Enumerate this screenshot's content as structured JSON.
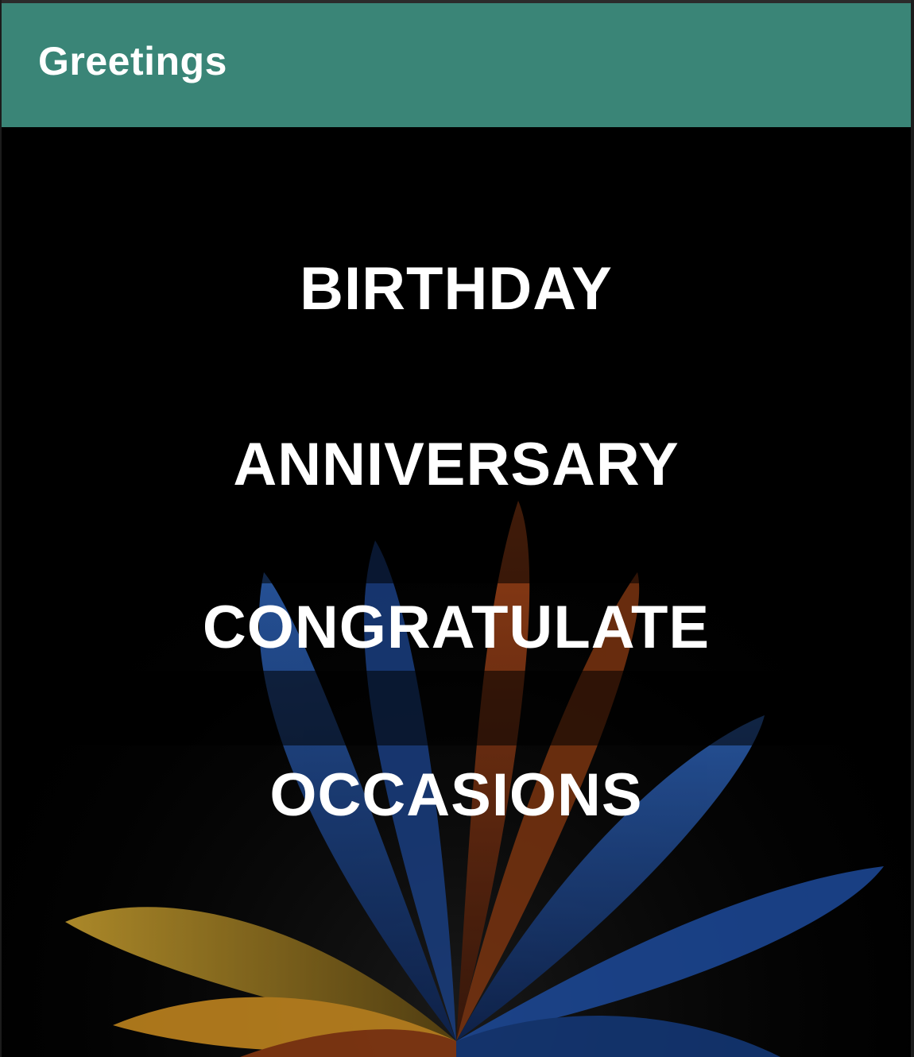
{
  "app_bar": {
    "title": "Greetings",
    "color": "#3a8577"
  },
  "menu": {
    "items": [
      {
        "label": "BIRTHDAY"
      },
      {
        "label": "ANNIVERSARY"
      },
      {
        "label": "CONGRATULATE"
      },
      {
        "label": "OCCASIONS"
      }
    ]
  },
  "background": {
    "image": "feathers-background",
    "colors": [
      "#1e4fa0",
      "#d8a520",
      "#b0501a"
    ]
  }
}
